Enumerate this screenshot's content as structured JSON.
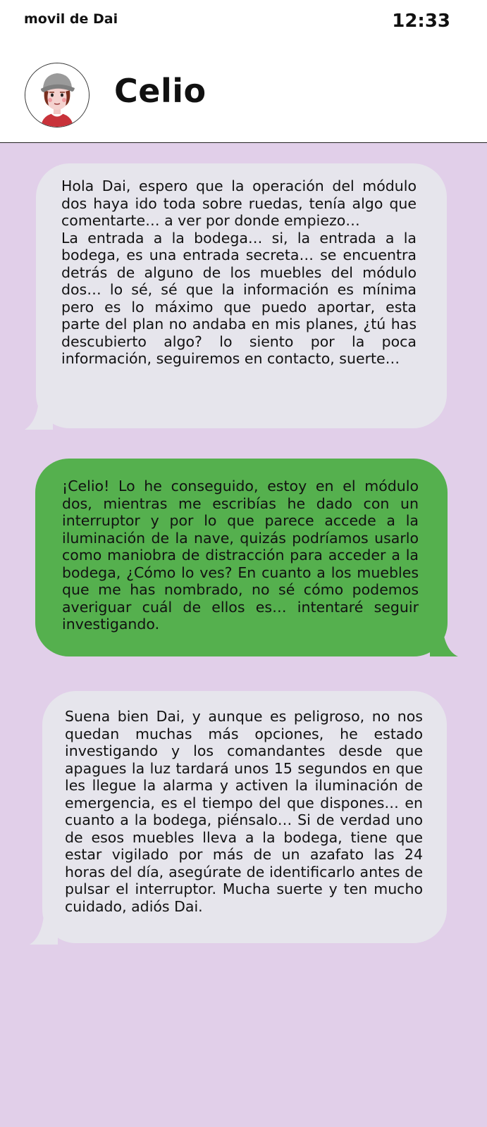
{
  "status_bar": {
    "device_name": "movil de Dai",
    "time": "12:33"
  },
  "header": {
    "contact_name": "Celio",
    "avatar_icon": "avatar-icon"
  },
  "colors": {
    "chat_background": "#e1cfe9",
    "incoming_bubble": "#e6e5ec",
    "outgoing_bubble": "#55b04e"
  },
  "messages": [
    {
      "direction": "incoming",
      "text": "Hola Dai, espero que la operación del módulo dos haya ido toda sobre ruedas, tenía algo que comentarte…  a ver por donde empiezo…\nLa entrada a la bodega… si, la entrada a la bodega, es una entrada secreta… se encuentra detrás de alguno de los muebles del módulo dos… lo sé, sé que la información es mínima pero es lo máximo que puedo aportar, esta parte del plan no andaba en mis planes, ¿tú has descubierto algo? lo siento por la poca información, seguiremos en contacto, suerte…"
    },
    {
      "direction": "outgoing",
      "text": "¡Celio! Lo he conseguido, estoy en el módulo dos, mientras me escribías he dado con un interruptor y por lo que parece accede a la iluminación de la nave, quizás podríamos usarlo como maniobra de distracción para acceder a la bodega, ¿Cómo lo ves? En cuanto a los muebles que me has nombrado, no sé cómo podemos averiguar cuál de ellos es… intentaré seguir investigando."
    },
    {
      "direction": "incoming",
      "text": "Suena bien Dai,  y aunque es peligroso, no nos quedan muchas más opciones, he estado investigando y los comandantes desde que apagues la luz tardará unos 15 segundos en que les llegue la alarma y activen la iluminación de emergencia, es el tiempo del que dispones… en cuanto a la bodega, piénsalo…  Si de verdad uno de esos muebles lleva a la bodega, tiene que estar vigilado por más de un azafato las 24 horas del día, asegúrate de identificarlo antes de pulsar el interruptor. Mucha suerte y ten mucho cuidado, adiós Dai."
    }
  ]
}
